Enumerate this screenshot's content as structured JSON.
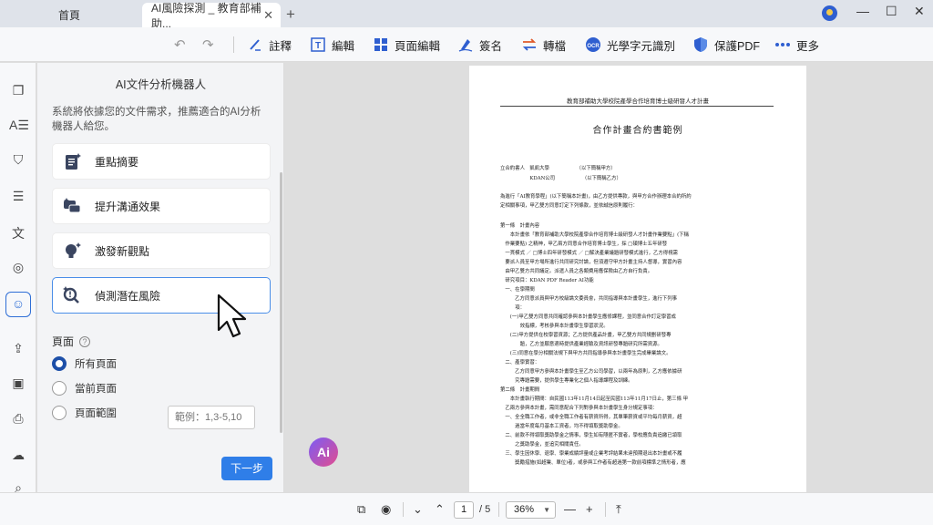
{
  "tabs": [
    {
      "label": "首頁"
    },
    {
      "label": "AI風險探測 _ 教育部補助...",
      "close": "✕"
    }
  ],
  "new_tab": "+",
  "window": {
    "minimize": "—",
    "maximize": "☐",
    "close": "✕"
  },
  "toolbar": {
    "items": [
      {
        "label": "註釋",
        "icon": "annotate-pen-icon"
      },
      {
        "label": "編輯",
        "icon": "edit-text-icon"
      },
      {
        "label": "頁面編輯",
        "icon": "page-grid-icon"
      },
      {
        "label": "簽名",
        "icon": "signature-icon"
      },
      {
        "label": "轉檔",
        "icon": "convert-arrows-icon"
      },
      {
        "label": "光學字元識別",
        "icon": "ocr-icon"
      },
      {
        "label": "保護PDF",
        "icon": "shield-icon"
      },
      {
        "label": "更多",
        "icon": "more-dots-icon"
      }
    ],
    "accent": "#2f5fd0"
  },
  "panel": {
    "title": "AI文件分析機器人",
    "description": "系統將依據您的文件需求，推薦適合的AI分析機器人給您。",
    "cards": [
      {
        "label": "重點摘要"
      },
      {
        "label": "提升溝通效果"
      },
      {
        "label": "激發新觀點"
      },
      {
        "label": "偵測潛在風險"
      }
    ],
    "pages_label": "頁面",
    "options": [
      {
        "label": "所有頁面"
      },
      {
        "label": "當前頁面"
      },
      {
        "label": "頁面範圍"
      }
    ],
    "range_placeholder": "範例：1,3-5,10",
    "next_label": "下一步",
    "accent": "#2f7ee8"
  },
  "document": {
    "header": "教育部補助大學校院產學合作培育博士級研發人才計畫",
    "title": "合作計畫合約書範例",
    "lines": [
      "立合約書人　凱凱大學　　　　　　（以下簡稱甲方）",
      "　　　　　　KDAN公司　　　　　　（以下簡稱乙方）",
      "為進行「AI教育學程」(以下簡稱本計畫)，由乙方提供專款，與甲方合作辦理本合約所約",
      "定相關事項，甲乙雙方同意訂定下列條款，並依誠信原則履行：",
      "第一條　計畫內容",
      "　　本計畫依「教育部補助大學校院產學合作培育博士級研發人才計畫作業要點」(下稱",
      "　作業要點) 之精神，甲乙兩方同意合作培育博士學生，採 □碩博士五年研發",
      "　一貫模式 ／ □博士四年研發模式 ／ □解決產業議題研發模式進行，乙方得視需",
      "　要派人員至甲方場所進行共同研究討論，但須遵守甲方計畫主持人督導，實習內容",
      "　由甲乙雙方共同議定。派遣人員之各類費用應保險由乙方自行負責。",
      "　研究項目：KDAN PDF Reader AI功能",
      "　一、在學期間",
      "　　　乙方同意派員與甲方校級論文委員會，共同指導與本計畫學生，進行下列事",
      "　　　項：",
      "　　(一)甲乙雙方同意共同確認參與本計畫學生應修課程，並同意合作訂定學習成",
      "　　　　效指標，考核參與本計畫學生學習狀況。",
      "　　(二)甲方提供在校學習資源；乙方提供產品計畫，甲乙雙方共同規劃研發專",
      "　　　　題，乙方並願意適時提供產業經驗及資訊研發專題研究所需資源。",
      "　　(三)同意在學分相關法規下與甲方共同指導參與本計畫學生完成畢業論文。",
      "　二、產學實習：",
      "　　　乙方同意甲方參與本計畫學生至乙方公司學習，以兩年為原則，乙方應依據研",
      "　　　究專題需要，提供學生專業化之個人指導課程及訓練。",
      "第二條　計畫期間",
      "　　本計畫執行期間：自民國113年11月14日起至民國113年11月17日止，第三條 甲",
      "　乙兩方參與本計畫，需同意配合下列對參與本計畫學生身分規定事項：",
      "　一、全全職工作者，或非全職工作者有薪資所得，其單筆薪資或平均每月薪資，超",
      "　　　過當年度每月基本工資者，均不得領取獎助學金。",
      "　二、前款不得領取獎助學金之情事，學生如有隱匿不實者，學校應負責追繳已領取",
      "　　　之獎助學金，並追究相關責任。",
      "　三、學生因休學、退學、學業成績評量或企業考評結果未達預期退出本計畫或不履",
      "　　　獎勵措施(如超業、單位)者，或參與工作者有超過第一款前項標準之情形者，應"
    ]
  },
  "ai_fab_label": "Ai",
  "bottombar": {
    "current_page": "1",
    "total_pages": "/ 5",
    "zoom": "36%",
    "minus": "—",
    "plus": "+"
  }
}
